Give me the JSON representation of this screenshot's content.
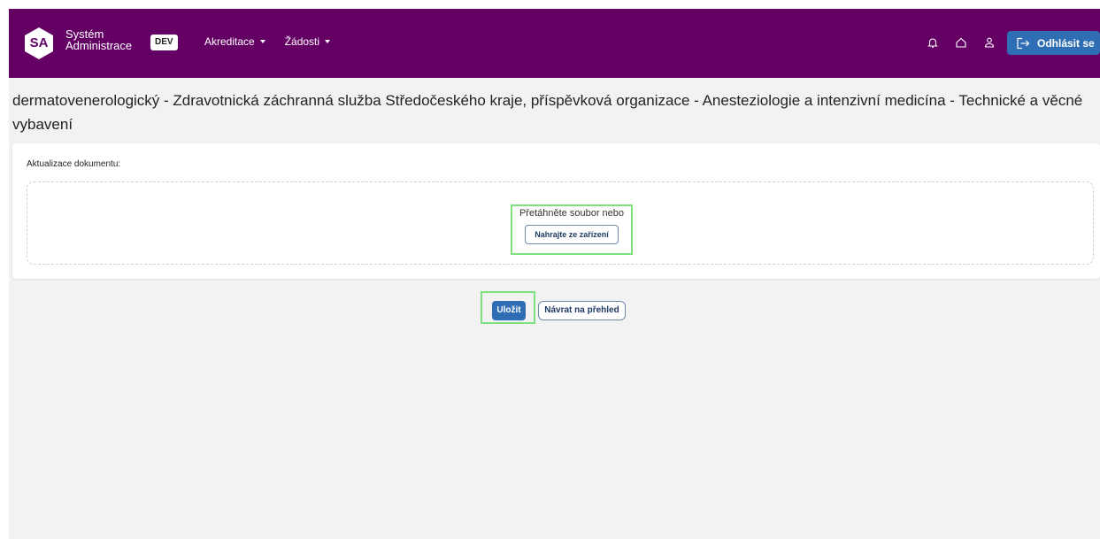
{
  "app": {
    "logo_text": "SA",
    "brand_line1": "Systém",
    "brand_line2": "Administrace",
    "env_badge": "DEV"
  },
  "nav": {
    "items": [
      {
        "label": "Akreditace"
      },
      {
        "label": "Žádosti"
      }
    ],
    "icons": [
      "bell-icon",
      "home-icon",
      "user-icon"
    ],
    "logout_label": "Odhlásit se"
  },
  "page": {
    "title": "dermatovenerologický - Zdravotnická záchranná služba Středočeského kraje, příspěvková organizace - Anesteziologie a intenzivní medicína - Technické a věcné vybavení"
  },
  "upload": {
    "section_label": "Aktualizace dokumentu:",
    "drop_text": "Přetáhněte soubor nebo",
    "upload_button": "Nahrajte ze zařízení"
  },
  "actions": {
    "save_label": "Uložit",
    "back_label": "Návrat na přehled"
  },
  "colors": {
    "navbar": "#640064",
    "primary": "#2f6eb5",
    "highlight": "#7ee07e"
  }
}
